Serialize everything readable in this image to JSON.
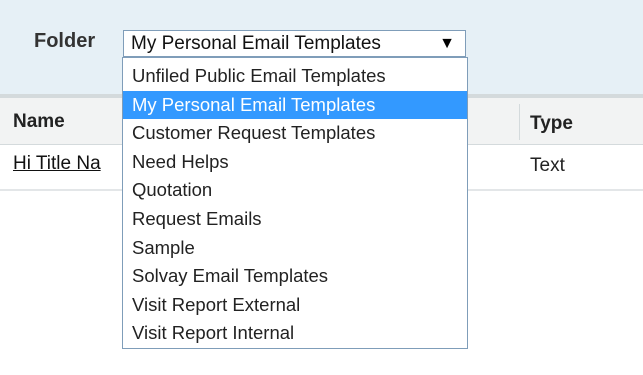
{
  "folder": {
    "label": "Folder",
    "selected_value": "My Personal Email Templates",
    "arrow_icon": "triangle-down-icon",
    "options": [
      {
        "label": "Unfiled Public Email Templates",
        "selected": false
      },
      {
        "label": "My Personal Email Templates",
        "selected": true
      },
      {
        "label": "Customer Request Templates",
        "selected": false
      },
      {
        "label": "Need Helps",
        "selected": false
      },
      {
        "label": "Quotation",
        "selected": false
      },
      {
        "label": "Request Emails",
        "selected": false
      },
      {
        "label": "Sample",
        "selected": false
      },
      {
        "label": "Solvay Email Templates",
        "selected": false
      },
      {
        "label": "Visit Report External",
        "selected": false
      },
      {
        "label": "Visit Report Internal",
        "selected": false
      }
    ]
  },
  "table": {
    "columns": {
      "name": "Name",
      "type": "Type"
    },
    "rows": [
      {
        "name": "Hi Title Na",
        "type": "Text"
      }
    ]
  },
  "colors": {
    "header_band": "#e6f0f6",
    "selected_option": "#3399ff",
    "select_border": "#7f9db9"
  }
}
